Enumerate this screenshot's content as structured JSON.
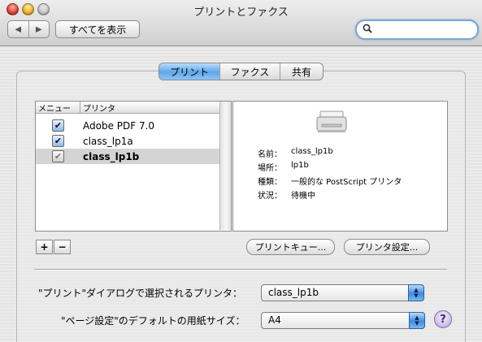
{
  "window": {
    "title": "プリントとファクス"
  },
  "toolbar": {
    "back_icon": "◀",
    "forward_icon": "▶",
    "show_all_label": "すべてを表示",
    "search_icon": "magnifier",
    "search_value": ""
  },
  "tabs": [
    {
      "label": "プリント",
      "active": true
    },
    {
      "label": "ファクス",
      "active": false
    },
    {
      "label": "共有",
      "active": false
    }
  ],
  "printer_list": {
    "columns": [
      "メニュー",
      "プリンタ"
    ],
    "rows": [
      {
        "checked": true,
        "name": "Adobe PDF 7.0",
        "selected": false
      },
      {
        "checked": true,
        "name": "class_lp1a",
        "selected": false
      },
      {
        "checked": true,
        "name": "class_lp1b",
        "selected": true
      }
    ]
  },
  "printer_info": {
    "name_label": "名前：",
    "name_value": "class_lp1b",
    "location_label": "場所：",
    "location_value": "lp1b",
    "kind_label": "種類：",
    "kind_value": "一般的な PostScript プリンタ",
    "status_label": "状況：",
    "status_value": "待機中"
  },
  "buttons": {
    "add": "+",
    "remove": "−",
    "print_queue": "プリントキュー...",
    "printer_setup": "プリンタ設定..."
  },
  "settings": {
    "print_dialog_label": "\"プリント\"ダイアログで選択されるプリンタ：",
    "print_dialog_value": "class_lp1b",
    "page_setup_label": "\"ページ設定\"のデフォルトの用紙サイズ：",
    "page_setup_value": "A4",
    "help": "?"
  },
  "colors": {
    "accent": "#5fa6ea",
    "selection": "#d4d4d4"
  }
}
